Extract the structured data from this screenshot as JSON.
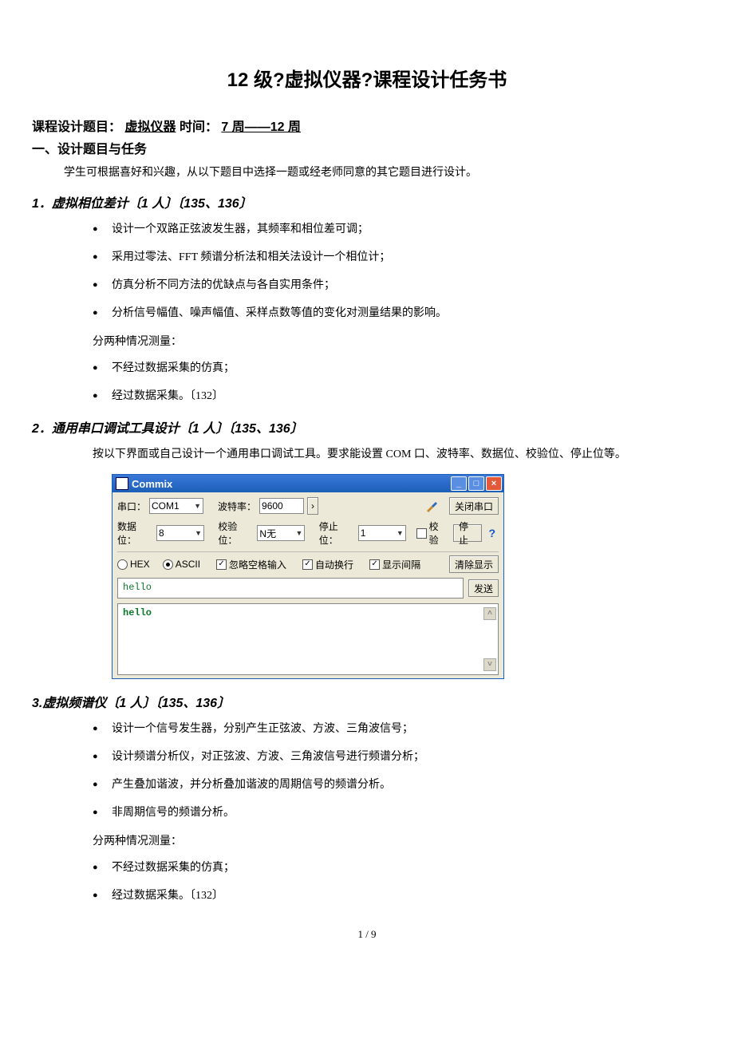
{
  "title": "12 级?虚拟仪器?课程设计任务书",
  "meta": {
    "label_topic": "课程设计题目：",
    "topic_value": "虚拟仪器",
    "label_time": " 时间：",
    "time_value": "7 周——12 周"
  },
  "section1_heading": "一、设计题目与任务",
  "intro": "学生可根据喜好和兴趣，从以下题目中选择一题或经老师同意的其它题目进行设计。",
  "topic1": {
    "heading": "1．虚拟相位差计〔1 人〕〔135、136〕",
    "bullets": [
      "设计一个双路正弦波发生器，其频率和相位差可调；",
      "采用过零法、FFT 频谱分析法和相关法设计一个相位计；",
      "仿真分析不同方法的优缺点与各自实用条件；",
      "分析信号幅值、噪声幅值、采样点数等值的变化对测量结果的影响。"
    ],
    "sub": "分两种情况测量：",
    "bullets2": [
      "不经过数据采集的仿真；",
      "经过数据采集。〔132〕"
    ]
  },
  "topic2": {
    "heading": "2．通用串口调试工具设计〔1 人〕〔135、136〕",
    "desc": "按以下界面或自己设计一个通用串口调试工具。要求能设置 COM 口、波特率、数据位、校验位、停止位等。"
  },
  "commix": {
    "title": "Commix",
    "row1": {
      "port_label": "串口：",
      "port_value": "COM1",
      "baud_label": "波特率：",
      "baud_value": "9600",
      "close_btn": "关闭串口"
    },
    "row2": {
      "databits_label": "数据位：",
      "databits_value": "8",
      "parity_label": "校验位：",
      "parity_value": "N无",
      "stopbits_label": "停止位：",
      "stopbits_value": "1",
      "check_label": "校验",
      "stop_btn": "停止"
    },
    "row3": {
      "hex": "HEX",
      "ascii": "ASCII",
      "ignore_space": "忽略空格输入",
      "auto_wrap": "自动换行",
      "show_gap": "显示间隔",
      "clear_btn": "清除显示"
    },
    "input_text": "hello",
    "send_btn": "发送",
    "output_text": "hello"
  },
  "topic3": {
    "heading": "3.虚拟频谱仪〔1 人〕〔135、136〕",
    "bullets": [
      "设计一个信号发生器，分别产生正弦波、方波、三角波信号；",
      "设计频谱分析仪，对正弦波、方波、三角波信号进行频谱分析；",
      "产生叠加谐波，并分析叠加谐波的周期信号的频谱分析。",
      "非周期信号的频谱分析。"
    ],
    "sub": "分两种情况测量：",
    "bullets2": [
      "不经过数据采集的仿真；",
      "经过数据采集。〔132〕"
    ]
  },
  "footer": "1 / 9"
}
